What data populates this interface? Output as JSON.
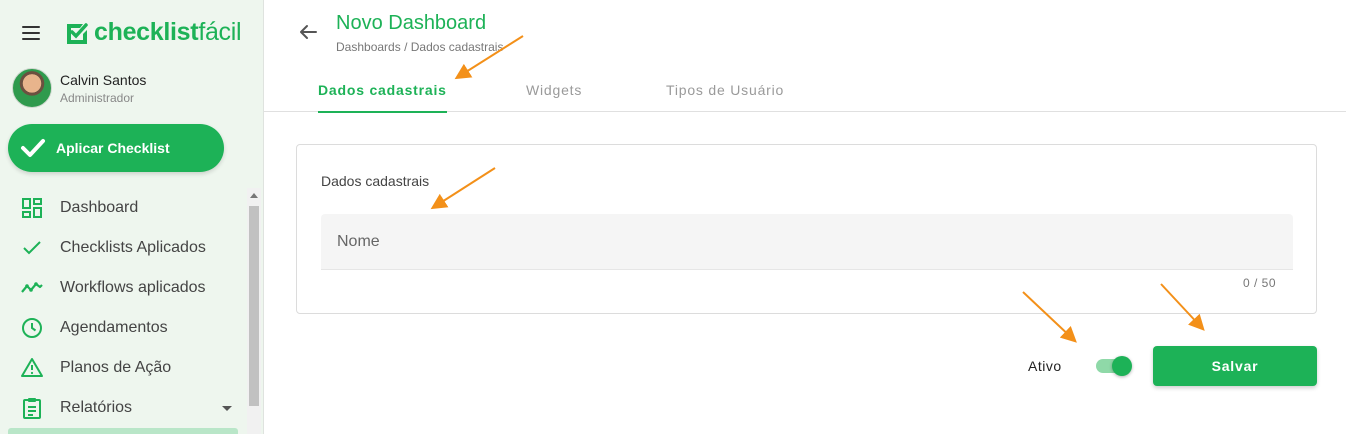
{
  "brand": {
    "name_bold": "checklist",
    "name_light": "fácil",
    "color": "#1db257"
  },
  "user": {
    "name": "Calvin Santos",
    "role": "Administrador"
  },
  "apply_button": {
    "label": "Aplicar Checklist"
  },
  "nav": {
    "items": [
      {
        "label": "Dashboard",
        "icon": "dashboard-icon"
      },
      {
        "label": "Checklists Aplicados",
        "icon": "check-icon"
      },
      {
        "label": "Workflows aplicados",
        "icon": "trend-icon"
      },
      {
        "label": "Agendamentos",
        "icon": "clock-icon"
      },
      {
        "label": "Planos de Ação",
        "icon": "warning-icon"
      },
      {
        "label": "Relatórios",
        "icon": "clipboard-icon"
      }
    ]
  },
  "header": {
    "title": "Novo Dashboard",
    "breadcrumb": {
      "parent": "Dashboards",
      "separator": "/",
      "current": "Dados cadastrais"
    }
  },
  "tabs": [
    {
      "label": "Dados cadastrais",
      "active": true
    },
    {
      "label": "Widgets",
      "active": false
    },
    {
      "label": "Tipos de Usuário",
      "active": false
    }
  ],
  "form": {
    "section_title": "Dados cadastrais",
    "name_field": {
      "placeholder": "Nome",
      "value": ""
    },
    "counter": "0 / 50"
  },
  "footer": {
    "active_label": "Ativo",
    "active_toggle_on": true,
    "save_label": "Salvar"
  },
  "annotation_color": "#f39019"
}
